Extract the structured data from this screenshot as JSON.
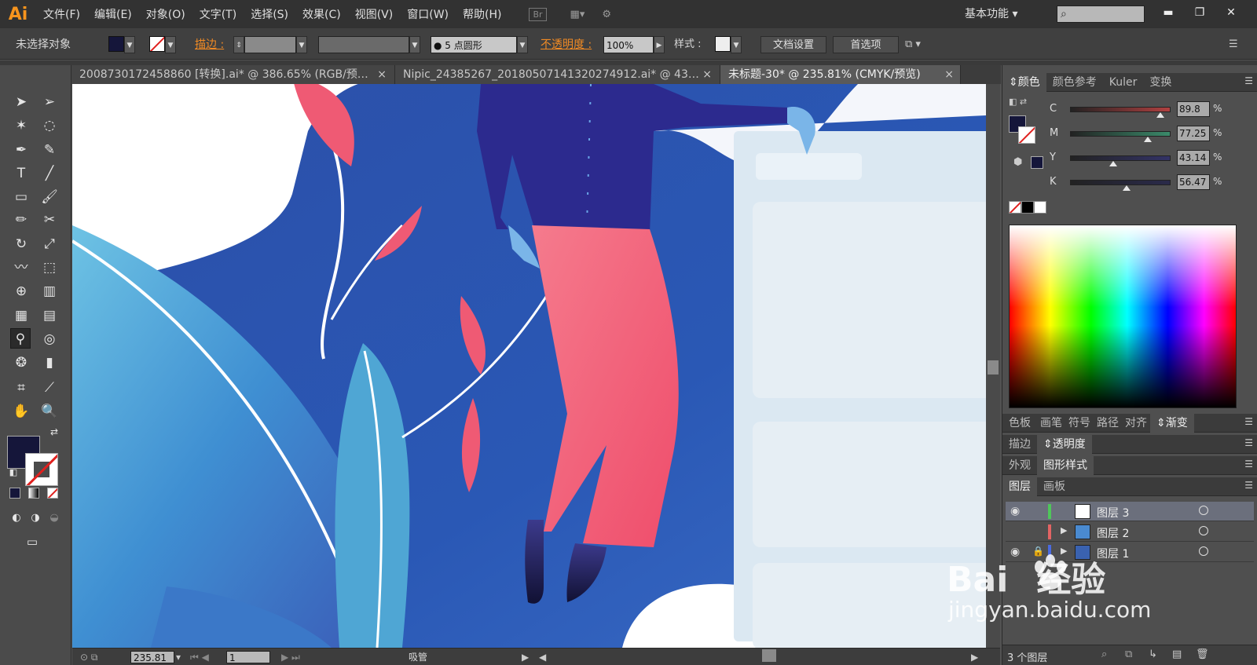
{
  "app": {
    "logo": "Ai"
  },
  "menu": [
    "文件(F)",
    "编辑(E)",
    "对象(O)",
    "文字(T)",
    "选择(S)",
    "效果(C)",
    "视图(V)",
    "窗口(W)",
    "帮助(H)"
  ],
  "menubar_extra": {
    "bridge_badge": "Br",
    "workspace": "基本功能",
    "search_placeholder": ""
  },
  "window_buttons": {
    "minimize": "▬",
    "restore": "❐",
    "close": "✕"
  },
  "control_bar": {
    "selection_status": "未选择对象",
    "fill_color": "#15163a",
    "stroke_label": "描边 :",
    "brush_label": "5 点圆形",
    "opacity_label": "不透明度 :",
    "opacity_value": "100%",
    "style_label": "样式 :",
    "doc_setup_button": "文档设置",
    "preferences_button": "首选项"
  },
  "tabs": [
    {
      "label": "200873017245886​0 [转换].ai* @ 386.65% (RGB/预…",
      "close": "×"
    },
    {
      "label": "Nipic_24385267_20180507141320274912.ai* @ 43…",
      "close": "×"
    },
    {
      "label": "未标题-30* @ 235.81% (CMYK/预览)",
      "close": "×"
    }
  ],
  "active_tab_index": 2,
  "status_bar": {
    "zoom": "235.81",
    "artboard": "1",
    "tool_name": "吸管"
  },
  "color_panel": {
    "tabs": [
      "颜色",
      "颜色参考",
      "Kuler",
      "变换"
    ],
    "active_tab": "颜色",
    "cmyk": [
      {
        "label": "C",
        "value": "89.8",
        "fraction": 0.898,
        "track": "#b04040"
      },
      {
        "label": "M",
        "value": "77.25",
        "fraction": 0.7725,
        "track": "#3a8a6a"
      },
      {
        "label": "Y",
        "value": "43.14",
        "fraction": 0.4314,
        "track": "#333366"
      },
      {
        "label": "K",
        "value": "56.47",
        "fraction": 0.5647,
        "track": "#2a2a4a"
      }
    ],
    "percent_sign": "%"
  },
  "panel_groups": [
    {
      "tabs": [
        "色板",
        "画笔",
        "符号",
        "路径",
        "对齐",
        "渐变"
      ],
      "active": "渐变"
    },
    {
      "tabs": [
        "描边",
        "透明度"
      ],
      "active": "透明度"
    },
    {
      "tabs": [
        "外观",
        "图形样式"
      ],
      "active": "图形样式"
    },
    {
      "tabs": [
        "图层",
        "画板"
      ],
      "active": "图层"
    }
  ],
  "layers": [
    {
      "name": "图层 3",
      "color": "#4fc65a",
      "selected": true
    },
    {
      "name": "图层 2",
      "color": "#e36464",
      "selected": false
    },
    {
      "name": "图层 1",
      "color": "#4a6ae0",
      "selected": false
    }
  ],
  "layers_footer": {
    "count": "3 个图层"
  },
  "watermark": {
    "brand": "Bai",
    "brand_suffix": "经验",
    "url": "jingyan.baidu.com"
  }
}
